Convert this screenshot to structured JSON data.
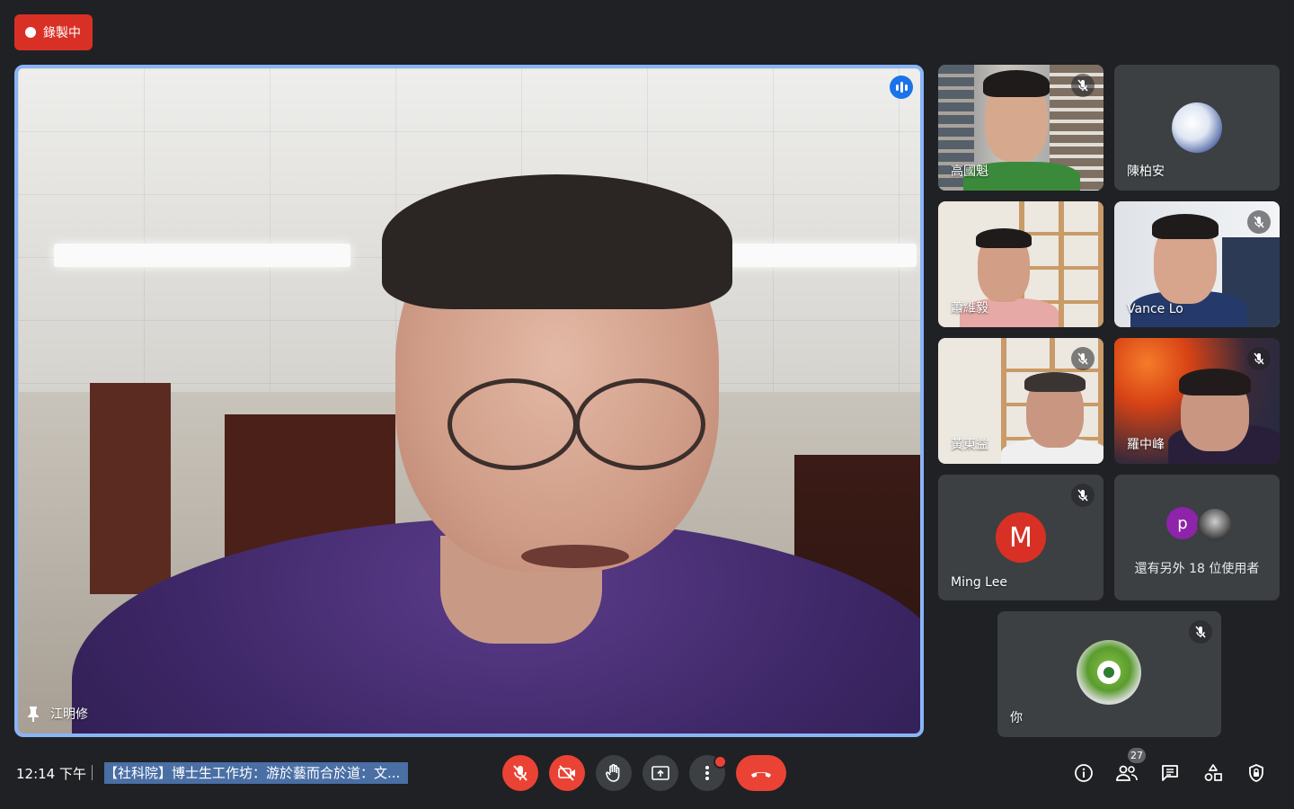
{
  "recording": {
    "label": "錄製中"
  },
  "main_speaker": {
    "name": "江明修",
    "pinned": true,
    "speaking": true
  },
  "tiles": [
    {
      "name": "高國魁",
      "muted": true
    },
    {
      "name": "陳柏安",
      "muted": false
    },
    {
      "name": "蕭維毅",
      "muted": false
    },
    {
      "name": "Vance Lo",
      "muted": true
    },
    {
      "name": "黃東益",
      "muted": true
    },
    {
      "name": "羅中峰",
      "muted": true
    },
    {
      "name": "Ming Lee",
      "muted": true,
      "avatar_letter": "M",
      "avatar_color": "#d93025"
    },
    {
      "name": "還有另外 18 位使用者",
      "avatar_letter": "p",
      "avatar_color": "#8e24aa"
    },
    {
      "name": "你",
      "muted": true
    }
  ],
  "bottom_bar": {
    "time": "12:14 下午",
    "meeting_title": "【社科院】博士生工作坊：游於藝而合於道：文...",
    "participant_count": "27"
  },
  "colors": {
    "accent": "#8ab4f8",
    "danger": "#ea4335",
    "bg": "#202124",
    "tile": "#3c4043"
  }
}
